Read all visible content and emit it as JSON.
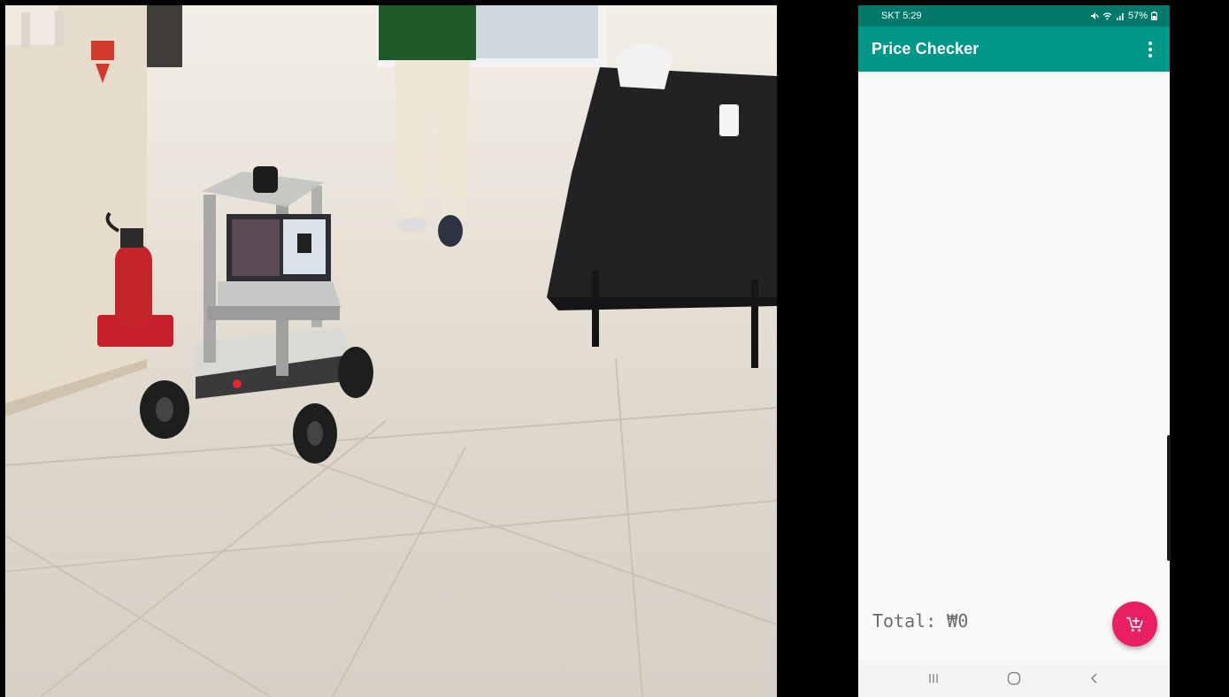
{
  "status_bar": {
    "left_text": "SKT 5:29",
    "right_text": "57%"
  },
  "app_bar": {
    "title": "Price Checker"
  },
  "footer": {
    "total_text": "Total: ₩0"
  },
  "fab": {
    "icon": "add-to-cart-icon"
  },
  "nav_bar": {
    "recents_icon": "recents-icon",
    "home_icon": "home-icon",
    "back_icon": "back-icon"
  },
  "colors": {
    "app_bar": "#009688",
    "status_bar": "#00796b",
    "fab": "#e91e63",
    "background": "#fafafa"
  }
}
